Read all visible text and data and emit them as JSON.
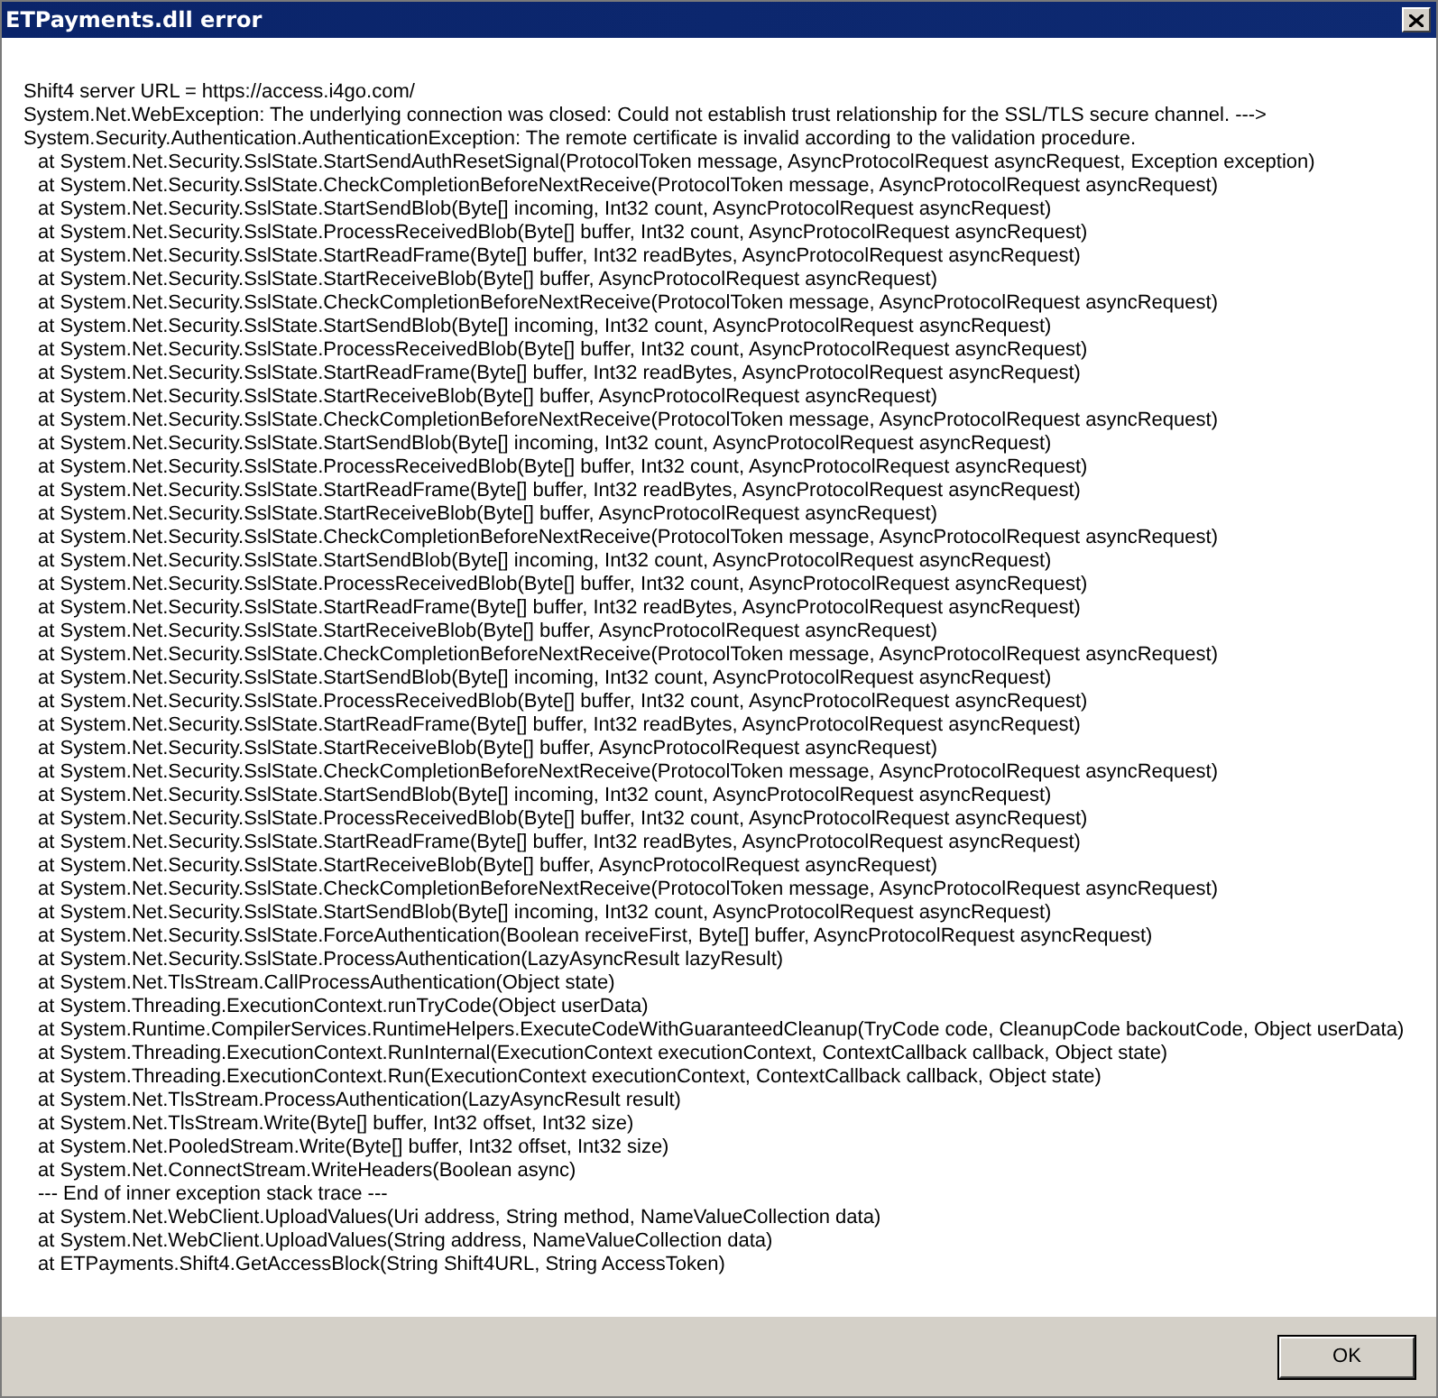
{
  "window": {
    "title": "ETPayments.dll error"
  },
  "message_lines": [
    {
      "kind": "message",
      "text": "Shift4 server URL = https://access.i4go.com/"
    },
    {
      "kind": "message",
      "text": "System.Net.WebException: The underlying connection was closed: Could not establish trust relationship for the SSL/TLS secure channel. --->"
    },
    {
      "kind": "message",
      "text": "System.Security.Authentication.AuthenticationException: The remote certificate is invalid according to the validation procedure."
    },
    {
      "kind": "frame",
      "text": "at System.Net.Security.SslState.StartSendAuthResetSignal(ProtocolToken message, AsyncProtocolRequest asyncRequest, Exception exception)"
    },
    {
      "kind": "frame",
      "text": "at System.Net.Security.SslState.CheckCompletionBeforeNextReceive(ProtocolToken message, AsyncProtocolRequest asyncRequest)"
    },
    {
      "kind": "frame",
      "text": "at System.Net.Security.SslState.StartSendBlob(Byte[] incoming, Int32 count, AsyncProtocolRequest asyncRequest)"
    },
    {
      "kind": "frame",
      "text": "at System.Net.Security.SslState.ProcessReceivedBlob(Byte[] buffer, Int32 count, AsyncProtocolRequest asyncRequest)"
    },
    {
      "kind": "frame",
      "text": "at System.Net.Security.SslState.StartReadFrame(Byte[] buffer, Int32 readBytes, AsyncProtocolRequest asyncRequest)"
    },
    {
      "kind": "frame",
      "text": "at System.Net.Security.SslState.StartReceiveBlob(Byte[] buffer, AsyncProtocolRequest asyncRequest)"
    },
    {
      "kind": "frame",
      "text": "at System.Net.Security.SslState.CheckCompletionBeforeNextReceive(ProtocolToken message, AsyncProtocolRequest asyncRequest)"
    },
    {
      "kind": "frame",
      "text": "at System.Net.Security.SslState.StartSendBlob(Byte[] incoming, Int32 count, AsyncProtocolRequest asyncRequest)"
    },
    {
      "kind": "frame",
      "text": "at System.Net.Security.SslState.ProcessReceivedBlob(Byte[] buffer, Int32 count, AsyncProtocolRequest asyncRequest)"
    },
    {
      "kind": "frame",
      "text": "at System.Net.Security.SslState.StartReadFrame(Byte[] buffer, Int32 readBytes, AsyncProtocolRequest asyncRequest)"
    },
    {
      "kind": "frame",
      "text": "at System.Net.Security.SslState.StartReceiveBlob(Byte[] buffer, AsyncProtocolRequest asyncRequest)"
    },
    {
      "kind": "frame",
      "text": "at System.Net.Security.SslState.CheckCompletionBeforeNextReceive(ProtocolToken message, AsyncProtocolRequest asyncRequest)"
    },
    {
      "kind": "frame",
      "text": "at System.Net.Security.SslState.StartSendBlob(Byte[] incoming, Int32 count, AsyncProtocolRequest asyncRequest)"
    },
    {
      "kind": "frame",
      "text": "at System.Net.Security.SslState.ProcessReceivedBlob(Byte[] buffer, Int32 count, AsyncProtocolRequest asyncRequest)"
    },
    {
      "kind": "frame",
      "text": "at System.Net.Security.SslState.StartReadFrame(Byte[] buffer, Int32 readBytes, AsyncProtocolRequest asyncRequest)"
    },
    {
      "kind": "frame",
      "text": "at System.Net.Security.SslState.StartReceiveBlob(Byte[] buffer, AsyncProtocolRequest asyncRequest)"
    },
    {
      "kind": "frame",
      "text": "at System.Net.Security.SslState.CheckCompletionBeforeNextReceive(ProtocolToken message, AsyncProtocolRequest asyncRequest)"
    },
    {
      "kind": "frame",
      "text": "at System.Net.Security.SslState.StartSendBlob(Byte[] incoming, Int32 count, AsyncProtocolRequest asyncRequest)"
    },
    {
      "kind": "frame",
      "text": "at System.Net.Security.SslState.ProcessReceivedBlob(Byte[] buffer, Int32 count, AsyncProtocolRequest asyncRequest)"
    },
    {
      "kind": "frame",
      "text": "at System.Net.Security.SslState.StartReadFrame(Byte[] buffer, Int32 readBytes, AsyncProtocolRequest asyncRequest)"
    },
    {
      "kind": "frame",
      "text": "at System.Net.Security.SslState.StartReceiveBlob(Byte[] buffer, AsyncProtocolRequest asyncRequest)"
    },
    {
      "kind": "frame",
      "text": "at System.Net.Security.SslState.CheckCompletionBeforeNextReceive(ProtocolToken message, AsyncProtocolRequest asyncRequest)"
    },
    {
      "kind": "frame",
      "text": "at System.Net.Security.SslState.StartSendBlob(Byte[] incoming, Int32 count, AsyncProtocolRequest asyncRequest)"
    },
    {
      "kind": "frame",
      "text": "at System.Net.Security.SslState.ProcessReceivedBlob(Byte[] buffer, Int32 count, AsyncProtocolRequest asyncRequest)"
    },
    {
      "kind": "frame",
      "text": "at System.Net.Security.SslState.StartReadFrame(Byte[] buffer, Int32 readBytes, AsyncProtocolRequest asyncRequest)"
    },
    {
      "kind": "frame",
      "text": "at System.Net.Security.SslState.StartReceiveBlob(Byte[] buffer, AsyncProtocolRequest asyncRequest)"
    },
    {
      "kind": "frame",
      "text": "at System.Net.Security.SslState.CheckCompletionBeforeNextReceive(ProtocolToken message, AsyncProtocolRequest asyncRequest)"
    },
    {
      "kind": "frame",
      "text": "at System.Net.Security.SslState.StartSendBlob(Byte[] incoming, Int32 count, AsyncProtocolRequest asyncRequest)"
    },
    {
      "kind": "frame",
      "text": "at System.Net.Security.SslState.ProcessReceivedBlob(Byte[] buffer, Int32 count, AsyncProtocolRequest asyncRequest)"
    },
    {
      "kind": "frame",
      "text": "at System.Net.Security.SslState.StartReadFrame(Byte[] buffer, Int32 readBytes, AsyncProtocolRequest asyncRequest)"
    },
    {
      "kind": "frame",
      "text": "at System.Net.Security.SslState.StartReceiveBlob(Byte[] buffer, AsyncProtocolRequest asyncRequest)"
    },
    {
      "kind": "frame",
      "text": "at System.Net.Security.SslState.CheckCompletionBeforeNextReceive(ProtocolToken message, AsyncProtocolRequest asyncRequest)"
    },
    {
      "kind": "frame",
      "text": "at System.Net.Security.SslState.StartSendBlob(Byte[] incoming, Int32 count, AsyncProtocolRequest asyncRequest)"
    },
    {
      "kind": "frame",
      "text": "at System.Net.Security.SslState.ForceAuthentication(Boolean receiveFirst, Byte[] buffer, AsyncProtocolRequest asyncRequest)"
    },
    {
      "kind": "frame",
      "text": "at System.Net.Security.SslState.ProcessAuthentication(LazyAsyncResult lazyResult)"
    },
    {
      "kind": "frame",
      "text": "at System.Net.TlsStream.CallProcessAuthentication(Object state)"
    },
    {
      "kind": "frame",
      "text": "at System.Threading.ExecutionContext.runTryCode(Object userData)"
    },
    {
      "kind": "frame",
      "text": "at System.Runtime.CompilerServices.RuntimeHelpers.ExecuteCodeWithGuaranteedCleanup(TryCode code, CleanupCode backoutCode, Object userData)"
    },
    {
      "kind": "frame",
      "text": "at System.Threading.ExecutionContext.RunInternal(ExecutionContext executionContext, ContextCallback callback, Object state)"
    },
    {
      "kind": "frame",
      "text": "at System.Threading.ExecutionContext.Run(ExecutionContext executionContext, ContextCallback callback, Object state)"
    },
    {
      "kind": "frame",
      "text": "at System.Net.TlsStream.ProcessAuthentication(LazyAsyncResult result)"
    },
    {
      "kind": "frame",
      "text": "at System.Net.TlsStream.Write(Byte[] buffer, Int32 offset, Int32 size)"
    },
    {
      "kind": "frame",
      "text": "at System.Net.PooledStream.Write(Byte[] buffer, Int32 offset, Int32 size)"
    },
    {
      "kind": "frame",
      "text": "at System.Net.ConnectStream.WriteHeaders(Boolean async)"
    },
    {
      "kind": "frame",
      "text": "--- End of inner exception stack trace ---"
    },
    {
      "kind": "frame",
      "text": "at System.Net.WebClient.UploadValues(Uri address, String method, NameValueCollection data)"
    },
    {
      "kind": "frame",
      "text": "at System.Net.WebClient.UploadValues(String address, NameValueCollection data)"
    },
    {
      "kind": "frame",
      "text": "at ETPayments.Shift4.GetAccessBlock(String Shift4URL, String AccessToken)"
    }
  ],
  "buttons": [
    {
      "label": "OK"
    }
  ]
}
